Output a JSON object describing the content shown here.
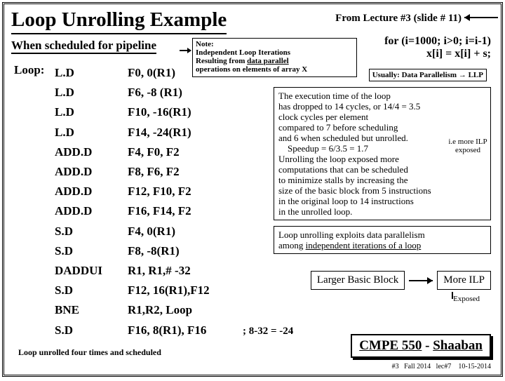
{
  "title": "Loop Unrolling Example",
  "title_note": "From Lecture #3 (slide # 11)",
  "sched_heading": "When scheduled for pipeline",
  "loop_label": "Loop:",
  "code": [
    {
      "op": "L.D",
      "arg": "F0, 0(R1)"
    },
    {
      "op": "L.D",
      "arg": "F6, -8 (R1)"
    },
    {
      "op": "L.D",
      "arg": "F10, -16(R1)"
    },
    {
      "op": "L.D",
      "arg": "F14, -24(R1)"
    },
    {
      "op": "ADD.D",
      "arg": "F4, F0, F2"
    },
    {
      "op": "ADD.D",
      "arg": "F8, F6, F2"
    },
    {
      "op": "ADD.D",
      "arg": "F12, F10, F2"
    },
    {
      "op": "ADD.D",
      "arg": "F16, F14, F2"
    },
    {
      "op": "S.D",
      "arg": "F4, 0(R1)"
    },
    {
      "op": "S.D",
      "arg": "F8, -8(R1)"
    },
    {
      "op": "DADDUI",
      "arg": "R1, R1,# -32"
    },
    {
      "op": "S.D",
      "arg": "F12, 16(R1),F12"
    },
    {
      "op": "BNE",
      "arg": "R1,R2, Loop"
    },
    {
      "op": "S.D",
      "arg": "F16, 8(R1), F16"
    }
  ],
  "note": {
    "heading": "Note:",
    "line1": "Independent Loop Iterations",
    "line2_a": "Resulting from ",
    "line2_u": "data parallel",
    "line3": "operations on elements of array X"
  },
  "forloop": {
    "line1": "for (i=1000; i>0; i=i-1)",
    "line2": "x[i] = x[i] + s;"
  },
  "usually": "Usually:   Data Parallelism → LLP",
  "commentary": {
    "l1": "The execution time of the loop",
    "l2": "has dropped to 14 cycles, or 14/4 = 3.5",
    "l3": "clock cycles per element",
    "l4": "compared to 7 before scheduling",
    "l5": "and 6 when scheduled but unrolled.",
    "l6": "    Speedup = 6/3.5 = 1.7",
    "l7": "Unrolling the loop exposed more",
    "l8": "computations that can be scheduled",
    "l9": "to minimize stalls by increasing the",
    "l10": "size of the basic block from 5 instructions",
    "l11": "in the original loop to 14 instructions",
    "l12": "in the unrolled loop."
  },
  "ilp_side": "i.e more ILP exposed",
  "exploit": {
    "l1_a": "Loop unrolling exploits data parallelism",
    "l2_a": "among ",
    "l2_u": "independent iterations of a loop"
  },
  "larger": {
    "left": "Larger Basic Block",
    "right": "More ILP"
  },
  "exposed": "Exposed",
  "eq_note": "; 8-32 = -24",
  "bottom_note": "Loop unrolled four times and scheduled",
  "course": {
    "a": "CMPE 550",
    "b": " - ",
    "c": "Shaaban"
  },
  "date_line": "#3   Fall 2014   lec#7    10-15-2014"
}
